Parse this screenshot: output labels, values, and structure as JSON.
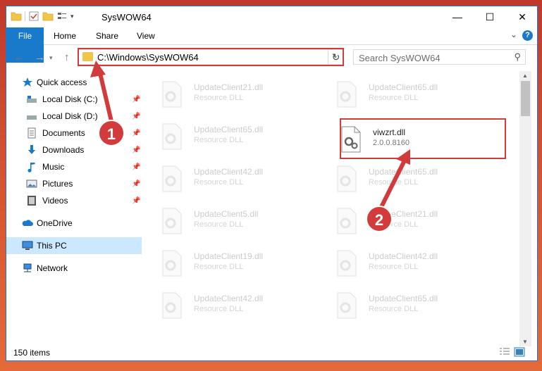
{
  "window": {
    "title": "SysWOW64"
  },
  "window_controls": {
    "minimize": "—",
    "maximize": "☐",
    "close": "✕"
  },
  "ribbon": {
    "tabs": [
      "File",
      "Home",
      "Share",
      "View"
    ]
  },
  "address_bar": {
    "path": "C:\\Windows\\SysWOW64"
  },
  "search": {
    "placeholder": "Search SysWOW64"
  },
  "nav_pane": {
    "items": [
      {
        "label": "Quick access",
        "icon": "star-icon"
      },
      {
        "label": "Local Disk (C:)",
        "icon": "drive-icon",
        "pinned": true
      },
      {
        "label": "Local Disk (D:)",
        "icon": "drive-icon",
        "pinned": true
      },
      {
        "label": "Documents",
        "icon": "documents-icon",
        "pinned": true
      },
      {
        "label": "Downloads",
        "icon": "downloads-icon",
        "pinned": true
      },
      {
        "label": "Music",
        "icon": "music-icon",
        "pinned": true
      },
      {
        "label": "Pictures",
        "icon": "pictures-icon",
        "pinned": true
      },
      {
        "label": "Videos",
        "icon": "videos-icon",
        "pinned": true
      },
      {
        "label": "OneDrive",
        "icon": "onedrive-icon"
      },
      {
        "label": "This PC",
        "icon": "this-pc-icon",
        "selected": true
      },
      {
        "label": "Network",
        "icon": "network-icon"
      }
    ]
  },
  "files": {
    "left_column": [
      {
        "name": "UpdateClient21.dll",
        "type": "Resource DLL"
      },
      {
        "name": "UpdateClient65.dll",
        "type": "Resource DLL"
      },
      {
        "name": "UpdateClient42.dll",
        "type": "Resource DLL"
      },
      {
        "name": "UpdateClient5.dll",
        "type": "Resource DLL"
      },
      {
        "name": "UpdateClient19.dll",
        "type": "Resource DLL"
      },
      {
        "name": "UpdateClient42.dll",
        "type": "Resource DLL"
      }
    ],
    "right_column": [
      {
        "name": "UpdateClient65.dll",
        "type": "Resource DLL"
      },
      {
        "name": "viwzrt.dll",
        "type": "2.0.0.8160",
        "highlighted": true
      },
      {
        "name": "UpdateClient65.dll",
        "type": "Resource DLL"
      },
      {
        "name": "UpdateClient21.dll",
        "type": "Resource DLL"
      },
      {
        "name": "UpdateClient42.dll",
        "type": "Resource DLL"
      },
      {
        "name": "UpdateClient65.dll",
        "type": "Resource DLL"
      }
    ]
  },
  "status_bar": {
    "item_count": "150 items"
  },
  "callouts": {
    "step1": "1",
    "step2": "2"
  },
  "colors": {
    "accent": "#1979ca",
    "highlight_box": "#d23b3b",
    "selected": "#cce8ff"
  }
}
